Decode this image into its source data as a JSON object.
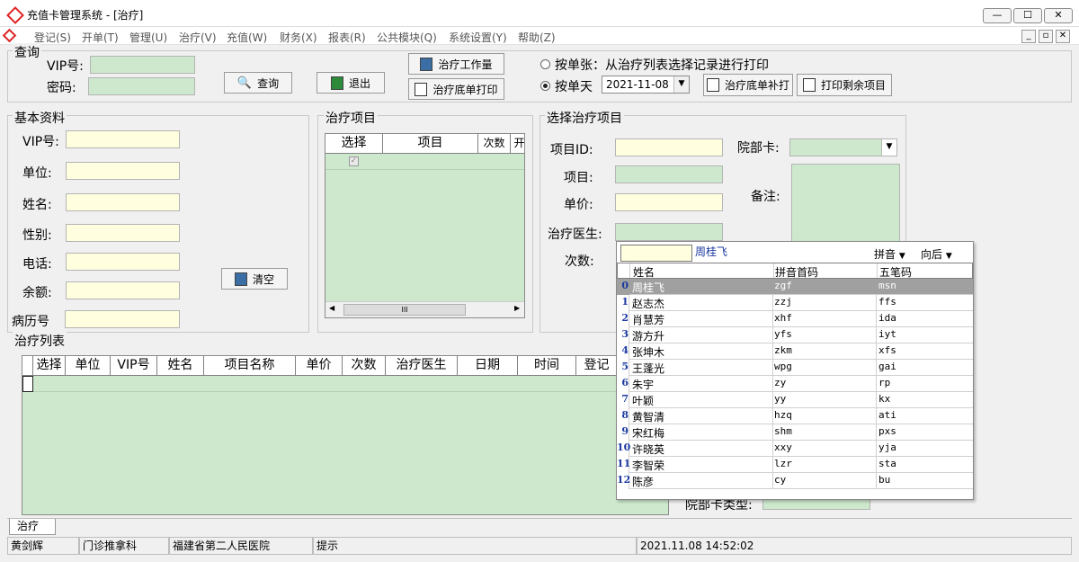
{
  "window": {
    "title": "充值卡管理系统 - [治疗]",
    "minimize": "—",
    "maximize": "☐",
    "close": "✕"
  },
  "menu": [
    "登记(S)",
    "开单(T)",
    "管理(U)",
    "治疗(V)",
    "充值(W)",
    "财务(X)",
    "报表(R)",
    "公共模块(Q)",
    "系统设置(Y)",
    "帮助(Z)"
  ],
  "mdi": {
    "minimize": "_",
    "restore": "▫",
    "close": "✕"
  },
  "query": {
    "title": "查询",
    "vip_label": "VIP号:",
    "pwd_label": "密码:",
    "query_btn": "查询",
    "exit_btn": "退出",
    "workload_btn": "治疗工作量",
    "print_btn": "治疗底单打印",
    "radio_single": "按单张：从治疗列表选择记录进行打印",
    "radio_day": "按单天",
    "date": "2021-11-08",
    "reprint_btn": "治疗底单补打",
    "print_rest_btn": "打印剩余项目"
  },
  "basic": {
    "title": "基本资料",
    "fields": [
      "VIP号:",
      "单位:",
      "姓名:",
      "性别:",
      "电话:",
      "余额:",
      "病历号"
    ],
    "clear_btn": "清空"
  },
  "items": {
    "title": "治疗项目",
    "cols": [
      "选择",
      "项目",
      "次数",
      "开"
    ],
    "scroll_thumb": "III"
  },
  "select": {
    "title": "选择治疗项目",
    "id_label": "项目ID:",
    "item_label": "项目:",
    "price_label": "单价:",
    "doctor_label": "治疗医生:",
    "count_label": "次数:",
    "card_label": "院部卡:",
    "note_label": "备注:",
    "card_type_label": "院部卡类型:"
  },
  "list": {
    "title": "治疗列表",
    "cols": [
      "选择",
      "单位",
      "VIP号",
      "姓名",
      "项目名称",
      "单价",
      "次数",
      "治疗医生",
      "日期",
      "时间",
      "登记"
    ]
  },
  "popup": {
    "search_value": "",
    "selected_name": "周桂飞",
    "pinyin_label": "拼音",
    "direction_label": "向后",
    "cols": [
      "姓名",
      "拼音首码",
      "五笔码"
    ],
    "rows": [
      {
        "n": "0",
        "name": "周桂飞",
        "py": "zgf",
        "wb": "msn"
      },
      {
        "n": "1",
        "name": "赵志杰",
        "py": "zzj",
        "wb": "ffs"
      },
      {
        "n": "2",
        "name": "肖慧芳",
        "py": "xhf",
        "wb": "ida"
      },
      {
        "n": "3",
        "name": "游方升",
        "py": "yfs",
        "wb": "iyt"
      },
      {
        "n": "4",
        "name": "张坤木",
        "py": "zkm",
        "wb": "xfs"
      },
      {
        "n": "5",
        "name": "王蓬光",
        "py": "wpg",
        "wb": "gai"
      },
      {
        "n": "6",
        "name": "朱宇",
        "py": "zy",
        "wb": "rp"
      },
      {
        "n": "7",
        "name": "叶颖",
        "py": "yy",
        "wb": "kx"
      },
      {
        "n": "8",
        "name": "黄智清",
        "py": "hzq",
        "wb": "ati"
      },
      {
        "n": "9",
        "name": "宋红梅",
        "py": "shm",
        "wb": "pxs"
      },
      {
        "n": "10",
        "name": "许晓英",
        "py": "xxy",
        "wb": "yja"
      },
      {
        "n": "11",
        "name": "李智荣",
        "py": "lzr",
        "wb": "sta"
      },
      {
        "n": "12",
        "name": "陈彦",
        "py": "cy",
        "wb": "bu"
      }
    ]
  },
  "tab": "治疗",
  "status": {
    "user": "黄剑辉",
    "dept": "门诊推拿科",
    "hospital": "福建省第二人民医院",
    "hint": "提示",
    "datetime": "2021.11.08 14:52:02"
  },
  "colors": {
    "input_yellow": "#ffffe0",
    "input_green": "#cde8cd",
    "selected_row": "#a0a0a0"
  }
}
